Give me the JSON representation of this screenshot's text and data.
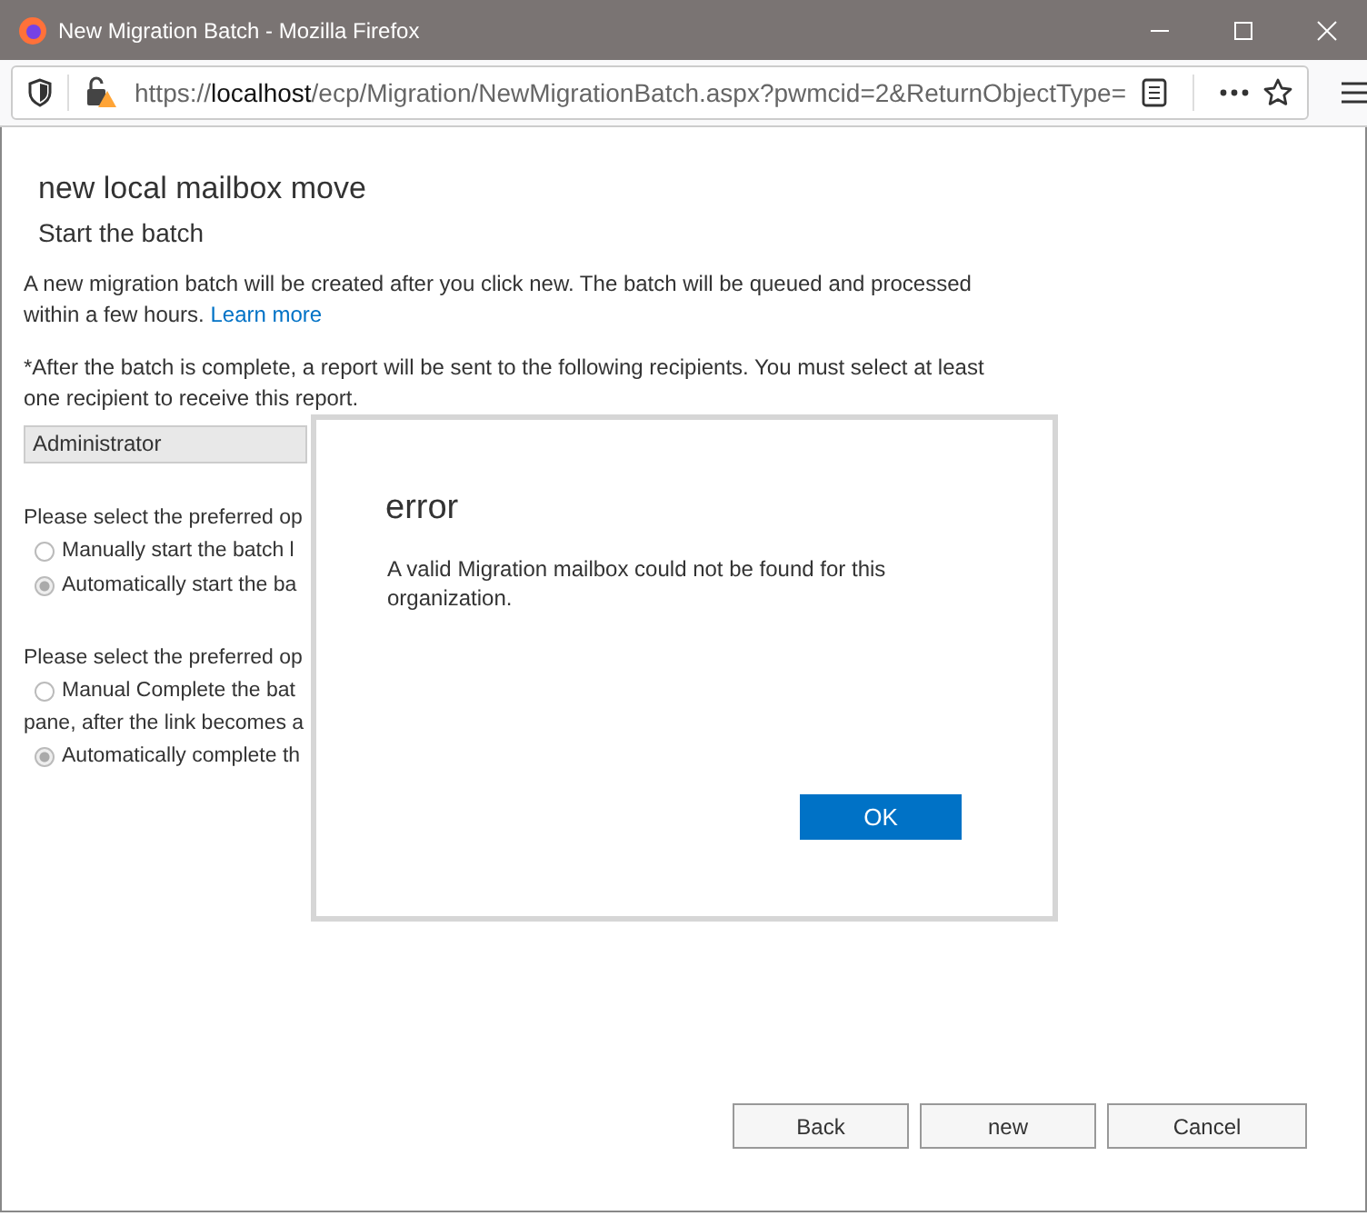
{
  "window": {
    "title": "New Migration Batch - Mozilla Firefox"
  },
  "address_bar": {
    "url_prefix": "https://",
    "url_host": "localhost",
    "url_rest": "/ecp/Migration/NewMigrationBatch.aspx?pwmcid=2&ReturnObjectType="
  },
  "page": {
    "title": "new local mailbox move",
    "subtitle": "Start the batch",
    "intro": "A new migration batch will be created after you click new. The batch will be queued and processed within a few hours.",
    "learn_more": "Learn more",
    "report_note": "*After the batch is complete, a report will be sent to the following recipients. You must select at least one recipient to receive this report.",
    "recipient": "Administrator",
    "start_prompt": "Please select the preferred op",
    "start_options": [
      {
        "label": "Manually start the batch l",
        "selected": false
      },
      {
        "label": "Automatically start the ba",
        "selected": true
      }
    ],
    "complete_prompt": "Please select the preferred op",
    "complete_options": [
      {
        "label": "Manual Complete the bat",
        "continuation": "pane, after the link becomes a",
        "selected": false
      },
      {
        "label": "Automatically complete th",
        "selected": true
      }
    ],
    "buttons": [
      "Back",
      "new",
      "Cancel"
    ]
  },
  "dialog": {
    "title": "error",
    "message": "A valid Migration mailbox could not be found for this organization.",
    "button": "OK"
  }
}
